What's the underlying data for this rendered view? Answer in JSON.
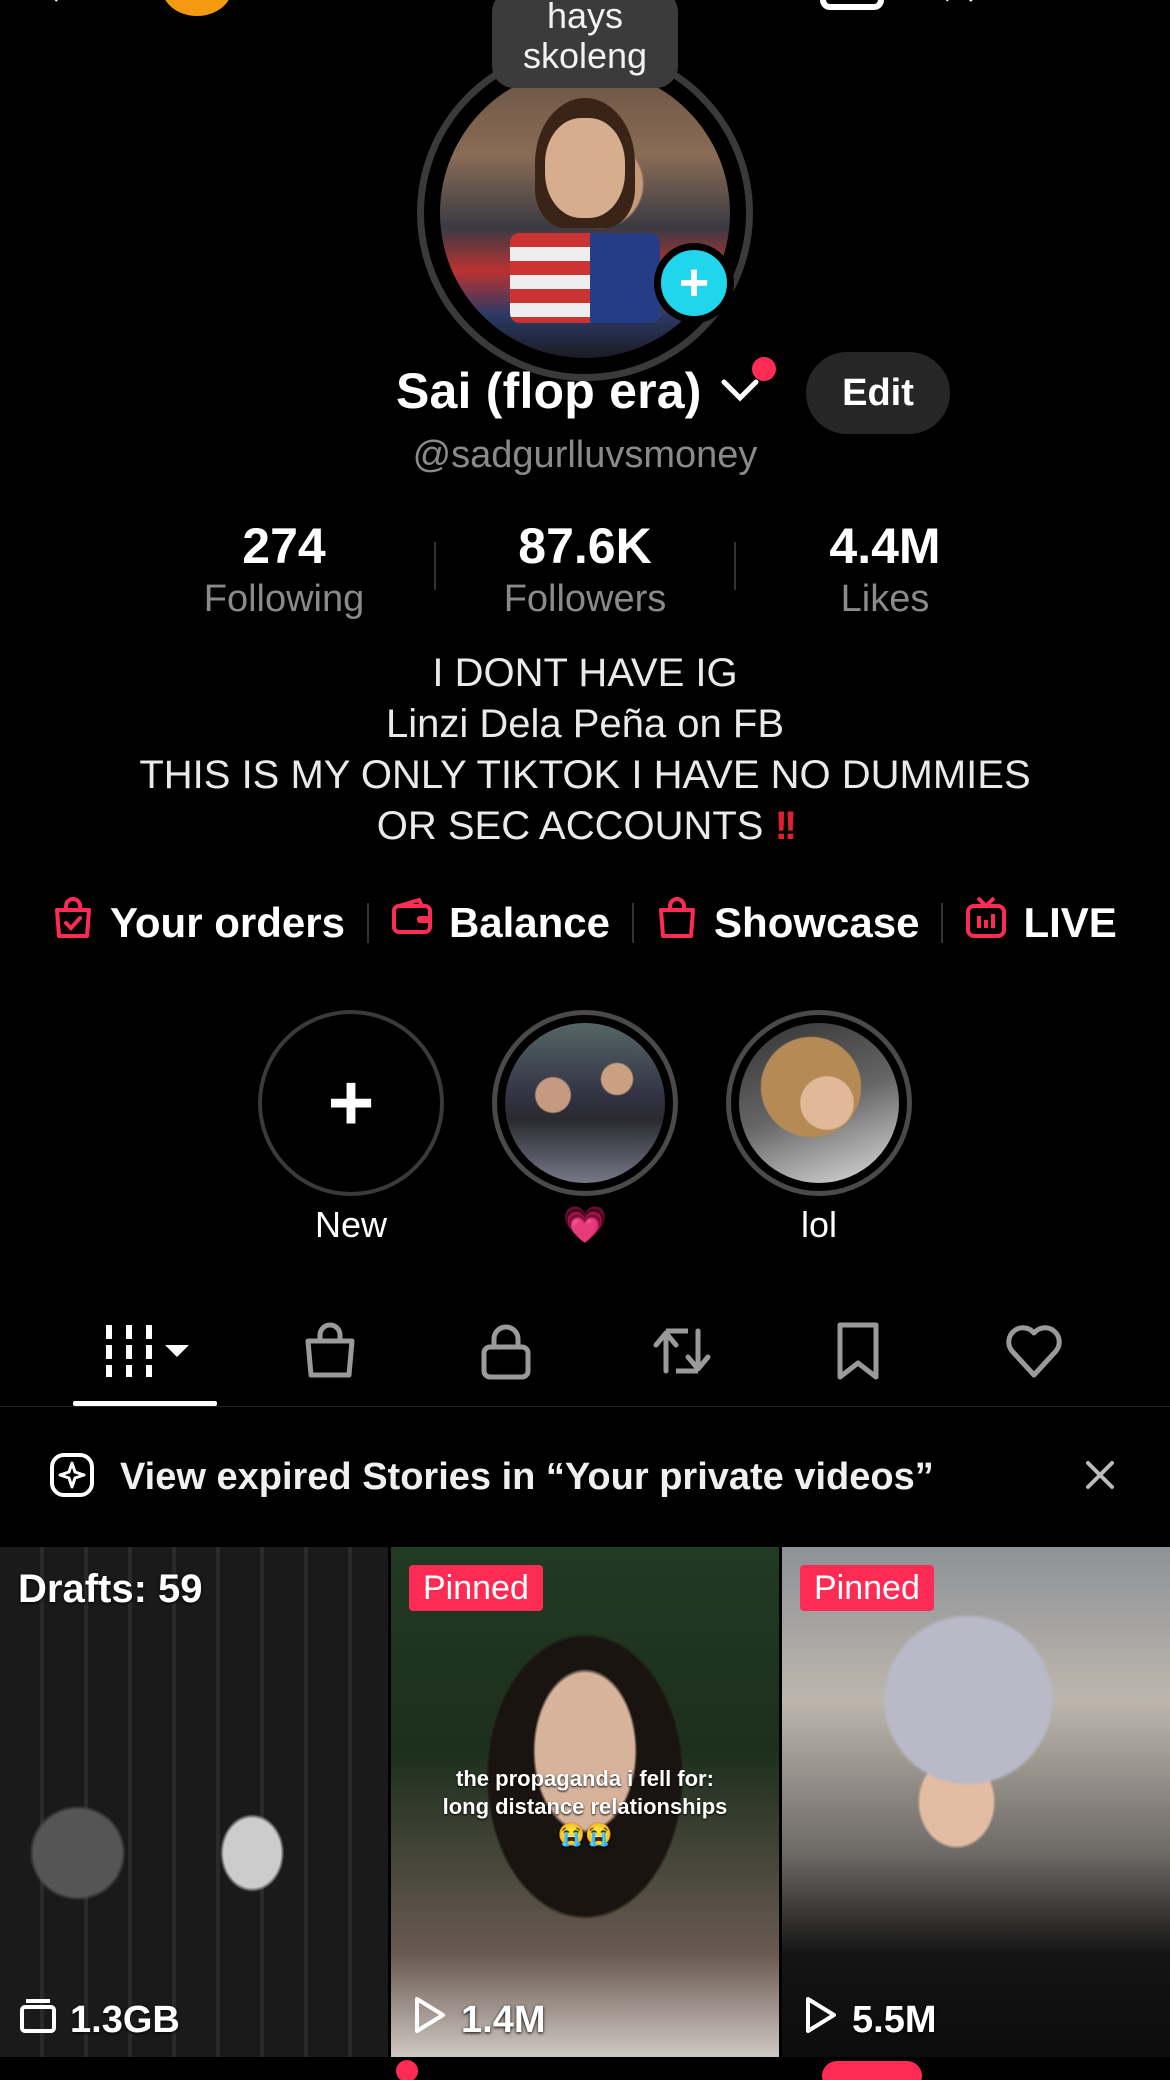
{
  "colors": {
    "accent": "#fe2c55",
    "cyan": "#20d5ec",
    "muted": "#8a8a8a"
  },
  "note": {
    "line1": "hays",
    "line2": "skoleng"
  },
  "profile": {
    "name": "Sai (flop era)",
    "handle": "@sadgurlluvsmoney",
    "edit_label": "Edit"
  },
  "stats": [
    {
      "value": "274",
      "label": "Following"
    },
    {
      "value": "87.6K",
      "label": "Followers"
    },
    {
      "value": "4.4M",
      "label": "Likes"
    }
  ],
  "bio": {
    "line1": "I DONT HAVE IG",
    "line2": "Linzi Dela Peña on FB",
    "line3": "THIS IS MY ONLY TIKTOK I HAVE NO DUMMIES",
    "line4": "OR SEC ACCOUNTS",
    "emphasis": "!!"
  },
  "shop_links": [
    {
      "label": "Your orders",
      "icon": "shopping-bag-check-icon"
    },
    {
      "label": "Balance",
      "icon": "wallet-icon"
    },
    {
      "label": "Showcase",
      "icon": "shopping-bag-icon"
    },
    {
      "label": "LIVE",
      "icon": "live-tv-icon"
    }
  ],
  "highlights": [
    {
      "label": "New"
    },
    {
      "label": "💗"
    },
    {
      "label": "lol"
    }
  ],
  "tabs": [
    {
      "name": "videos",
      "icon": "grid-dropdown-icon",
      "active": true
    },
    {
      "name": "shop",
      "icon": "shopping-bag-icon"
    },
    {
      "name": "private",
      "icon": "lock-icon"
    },
    {
      "name": "reposts",
      "icon": "repost-icon"
    },
    {
      "name": "favorites",
      "icon": "bookmark-icon"
    },
    {
      "name": "liked",
      "icon": "heart-icon"
    }
  ],
  "banner": {
    "text": "View expired Stories in “Your private videos”"
  },
  "videos": [
    {
      "badge": "Drafts: 59",
      "footer": "1.3GB",
      "footer_icon": "drafts-stack-icon"
    },
    {
      "badge": "Pinned",
      "footer": "1.4M",
      "footer_icon": "play-icon",
      "caption_line1": "the propaganda i fell for:",
      "caption_line2": "long distance relationships",
      "caption_emoji": "😭😭"
    },
    {
      "badge": "Pinned",
      "footer": "5.5M",
      "footer_icon": "play-icon"
    }
  ]
}
